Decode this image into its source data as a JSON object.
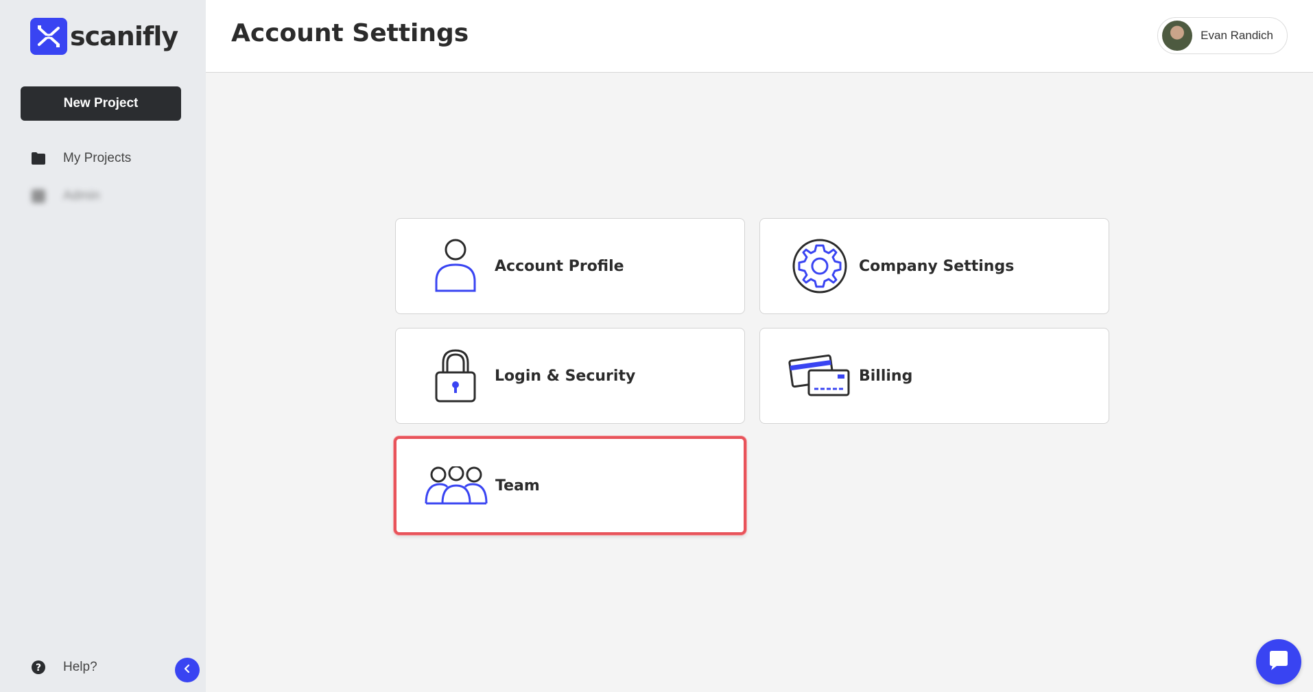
{
  "brand": {
    "name": "scanifly",
    "accent": "#3944f2"
  },
  "sidebar": {
    "new_project_label": "New Project",
    "items": [
      {
        "label": "My Projects",
        "icon": "folder-icon"
      },
      {
        "label": "Admin",
        "icon": "grid-icon"
      }
    ],
    "help_label": "Help?"
  },
  "header": {
    "title": "Account Settings",
    "user_name": "Evan Randich"
  },
  "cards": {
    "account_profile": "Account Profile",
    "company_settings": "Company Settings",
    "login_security": "Login & Security",
    "billing": "Billing",
    "team": "Team"
  },
  "colors": {
    "highlight": "#e8535a",
    "sidebar_bg": "#e9ebee",
    "button_dark": "#2b2d30"
  }
}
